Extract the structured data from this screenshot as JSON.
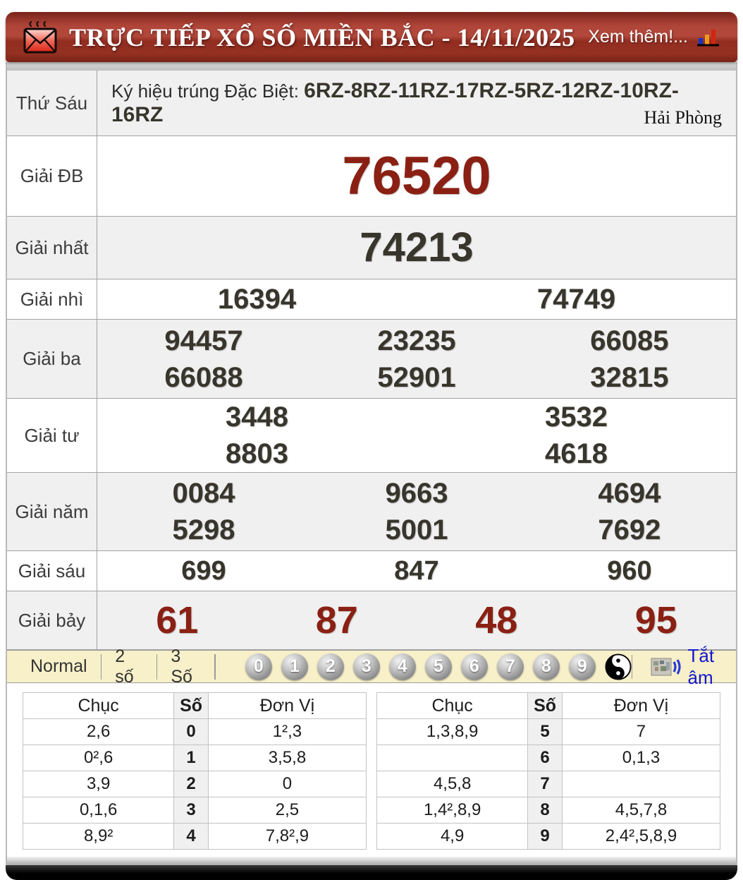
{
  "header": {
    "title": "TRỰC TIẾP XỔ SỐ MIỀN BẮC - 14/11/2025",
    "more_label": "Xem thêm!...",
    "accent_red": "#8a2013",
    "bar_red": "#a83d30"
  },
  "results": {
    "day_label": "Thứ Sáu",
    "symbol_label": "Ký hiệu trúng Đặc Biệt: ",
    "symbol_value": "6RZ-8RZ-11RZ-17RZ-5RZ-12RZ-10RZ-16RZ",
    "province": "Hải Phòng",
    "rows": [
      {
        "label": "Giải ĐB",
        "numbers": [
          "76520"
        ]
      },
      {
        "label": "Giải nhất",
        "numbers": [
          "74213"
        ]
      },
      {
        "label": "Giải nhì",
        "numbers": [
          "16394",
          "74749"
        ]
      },
      {
        "label": "Giải ba",
        "numbers": [
          "94457",
          "23235",
          "66085",
          "66088",
          "52901",
          "32815"
        ]
      },
      {
        "label": "Giải tư",
        "numbers": [
          "3448",
          "3532",
          "8803",
          "4618"
        ]
      },
      {
        "label": "Giải năm",
        "numbers": [
          "0084",
          "9663",
          "4694",
          "5298",
          "5001",
          "7692"
        ]
      },
      {
        "label": "Giải sáu",
        "numbers": [
          "699",
          "847",
          "960"
        ]
      },
      {
        "label": "Giải bảy",
        "numbers": [
          "61",
          "87",
          "48",
          "95"
        ]
      }
    ]
  },
  "controls": {
    "modes": [
      "Normal",
      "2 số",
      "3 Số"
    ],
    "balls": [
      "0",
      "1",
      "2",
      "3",
      "4",
      "5",
      "6",
      "7",
      "8",
      "9"
    ],
    "yinyang_icon": "yin-yang-icon",
    "mute_label": "Tắt âm",
    "mute_color": "#1418cf",
    "bar_color": "#f7f0c9"
  },
  "stats": {
    "headers": [
      "Chục",
      "Số",
      "Đơn Vị"
    ],
    "left": [
      [
        "2,6",
        "0",
        "1²,3"
      ],
      [
        "0²,6",
        "1",
        "3,5,8"
      ],
      [
        "3,9",
        "2",
        "0"
      ],
      [
        "0,1,6",
        "3",
        "2,5"
      ],
      [
        "8,9²",
        "4",
        "7,8²,9"
      ]
    ],
    "right": [
      [
        "1,3,8,9",
        "5",
        "7"
      ],
      [
        "",
        "6",
        "0,1,3"
      ],
      [
        "4,5,8",
        "7",
        ""
      ],
      [
        "1,4²,8,9",
        "8",
        "4,5,7,8"
      ],
      [
        "4,9",
        "9",
        "2,4²,5,8,9"
      ]
    ]
  }
}
